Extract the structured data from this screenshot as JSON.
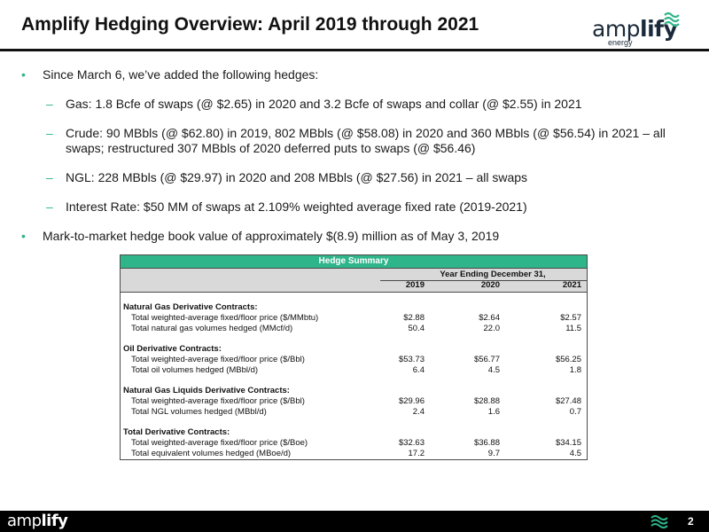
{
  "header": {
    "title": "Amplify Hedging Overview: April 2019 through 2021",
    "logo_word_regular": "amp",
    "logo_word_bold": "lify",
    "logo_sub": "energy",
    "logo_icon": "wave-mark-icon",
    "accent_color": "#2fb58a"
  },
  "bullets": {
    "intro": "Since March 6, we’ve added the following hedges:",
    "items": [
      "Gas: 1.8 Bcfe of swaps (@ $2.65) in 2020 and 3.2 Bcfe of swaps and collar (@ $2.55) in 2021",
      "Crude: 90 MBbls (@ $62.80) in 2019, 802 MBbls (@ $58.08) in 2020 and 360 MBbls (@ $56.54) in 2021 – all swaps; restructured 307 MBbls of 2020 deferred puts to swaps (@ $56.46)",
      "NGL: 228 MBbls (@ $29.97) in 2020 and 208 MBbls (@ $27.56) in 2021 – all swaps",
      "Interest Rate: $50 MM of swaps at 2.109% weighted average fixed rate (2019-2021)"
    ],
    "mtm": "Mark-to-market hedge book value of approximately $(8.9) million as of May 3, 2019"
  },
  "table": {
    "title": "Hedge Summary",
    "period_label": "Year Ending December 31,",
    "years": [
      "2019",
      "2020",
      "2021"
    ],
    "sections": [
      {
        "heading": "Natural Gas Derivative Contracts:",
        "rows": [
          {
            "label": "Total weighted-average fixed/floor price ($/MMbtu)",
            "values": [
              "$2.88",
              "$2.64",
              "$2.57"
            ]
          },
          {
            "label": "Total natural gas volumes hedged (MMcf/d)",
            "values": [
              "50.4",
              "22.0",
              "11.5"
            ]
          }
        ]
      },
      {
        "heading": "Oil Derivative Contracts:",
        "rows": [
          {
            "label": "Total weighted-average fixed/floor price ($/Bbl)",
            "values": [
              "$53.73",
              "$56.77",
              "$56.25"
            ]
          },
          {
            "label": "Total oil volumes hedged (MBbl/d)",
            "values": [
              "6.4",
              "4.5",
              "1.8"
            ]
          }
        ]
      },
      {
        "heading": "Natural Gas Liquids Derivative Contracts:",
        "rows": [
          {
            "label": "Total weighted-average fixed/floor price ($/Bbl)",
            "values": [
              "$29.96",
              "$28.88",
              "$27.48"
            ]
          },
          {
            "label": "Total NGL volumes hedged (MBbl/d)",
            "values": [
              "2.4",
              "1.6",
              "0.7"
            ]
          }
        ]
      },
      {
        "heading": "Total Derivative Contracts:",
        "rows": [
          {
            "label": "Total weighted-average fixed/floor price ($/Boe)",
            "values": [
              "$32.63",
              "$36.88",
              "$34.15"
            ]
          },
          {
            "label": "Total equivalent volumes hedged (MBoe/d)",
            "values": [
              "17.2",
              "9.7",
              "4.5"
            ]
          }
        ]
      }
    ]
  },
  "footer": {
    "logo_word_regular": "amp",
    "logo_word_bold": "lify",
    "page_number": "2"
  }
}
